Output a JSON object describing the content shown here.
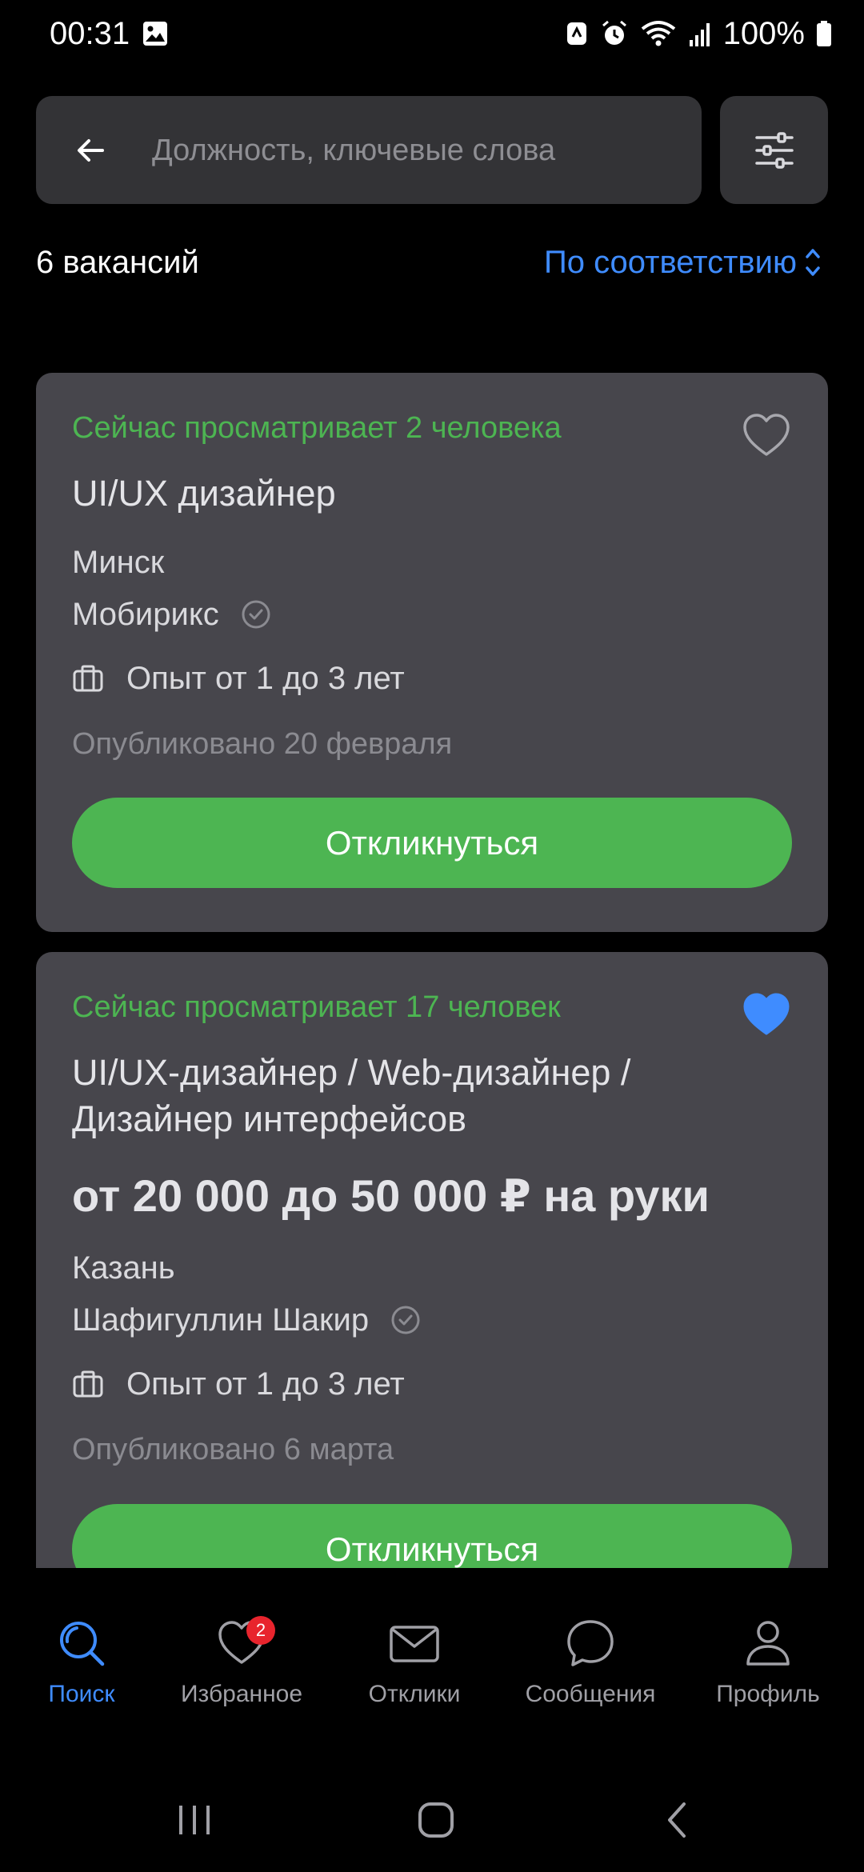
{
  "status_bar": {
    "time": "00:31",
    "battery": "100%"
  },
  "search": {
    "placeholder": "Должность, ключевые слова"
  },
  "results": {
    "count_label": "6 вакансий",
    "sort_label": "По соответствию"
  },
  "vacancies": [
    {
      "viewers": "Сейчас просматривает 2 человека",
      "title": "UI/UX дизайнер",
      "salary": "",
      "city": "Минск",
      "company": "Мобирикс",
      "experience": "Опыт от 1 до 3 лет",
      "published": "Опубликовано 20 февраля",
      "favorite": false,
      "button_label": "Откликнуться"
    },
    {
      "viewers": "Сейчас просматривает 17 человек",
      "title_line1": "UI/UX-дизайнер / Web-дизайнер /",
      "title_line2": "Дизайнер интерфейсов",
      "salary": "от 20 000 до 50 000 ₽ на руки",
      "city": "Казань",
      "company": "Шафигуллин Шакир",
      "experience": "Опыт от 1 до 3 лет",
      "published": "Опубликовано 6 марта",
      "favorite": true,
      "button_label": "Откликнуться"
    }
  ],
  "bottom_nav": {
    "items": [
      {
        "label": "Поиск",
        "icon": "search-icon",
        "active": true
      },
      {
        "label": "Избранное",
        "icon": "heart-icon",
        "badge": "2"
      },
      {
        "label": "Отклики",
        "icon": "envelope-icon"
      },
      {
        "label": "Сообщения",
        "icon": "chat-bubble-icon"
      },
      {
        "label": "Профиль",
        "icon": "person-icon"
      }
    ]
  },
  "colors": {
    "accent_blue": "#3f8cff",
    "green": "#4db552",
    "card_bg": "#47464c",
    "badge_red": "#e8242d"
  }
}
